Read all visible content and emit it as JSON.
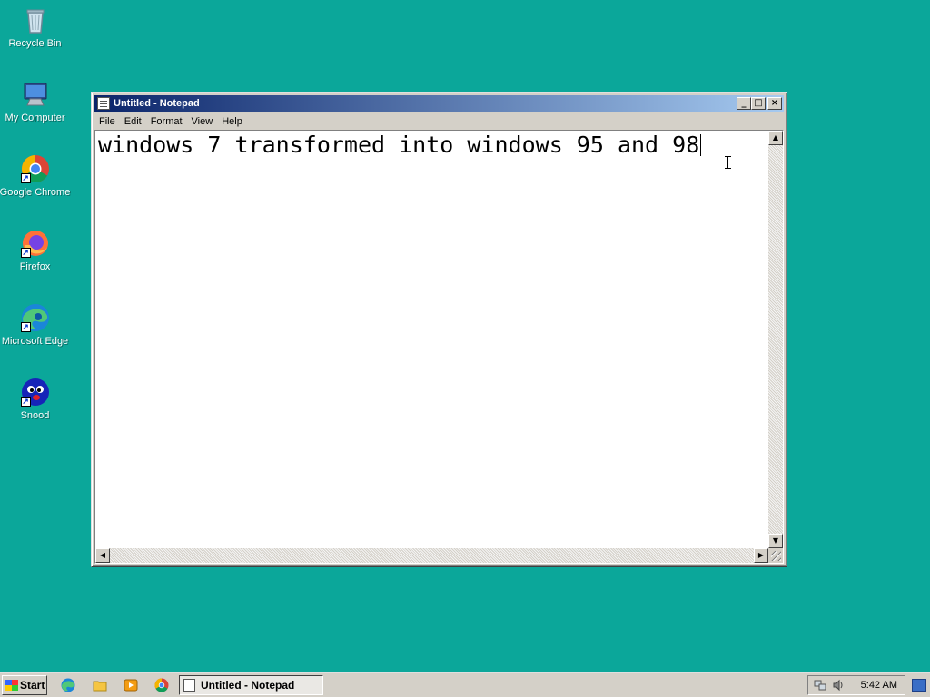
{
  "desktop": {
    "icons": [
      {
        "label": "Recycle Bin",
        "icon": "recycle-bin-icon"
      },
      {
        "label": "My Computer",
        "icon": "computer-icon"
      },
      {
        "label": "Google Chrome",
        "icon": "chrome-icon"
      },
      {
        "label": "Firefox",
        "icon": "firefox-icon"
      },
      {
        "label": "Microsoft Edge",
        "icon": "edge-icon"
      },
      {
        "label": "Snood",
        "icon": "snood-icon"
      }
    ]
  },
  "window": {
    "title": "Untitled - Notepad",
    "buttons": {
      "minimize": "_",
      "maximize": "□",
      "close": "×"
    },
    "menu": [
      "File",
      "Edit",
      "Format",
      "View",
      "Help"
    ],
    "content": "windows 7 transformed into windows 95 and 98"
  },
  "taskbar": {
    "start_label": "Start",
    "quick_launch": [
      "edge-icon",
      "folder-icon",
      "media-player-icon",
      "chrome-icon"
    ],
    "task_label": "Untitled - Notepad",
    "clock": "5:42 AM"
  },
  "colors": {
    "desktop": "#0ba79a",
    "title_active_start": "#0a246a",
    "title_active_end": "#a6caf0",
    "face": "#d4d0c8"
  }
}
